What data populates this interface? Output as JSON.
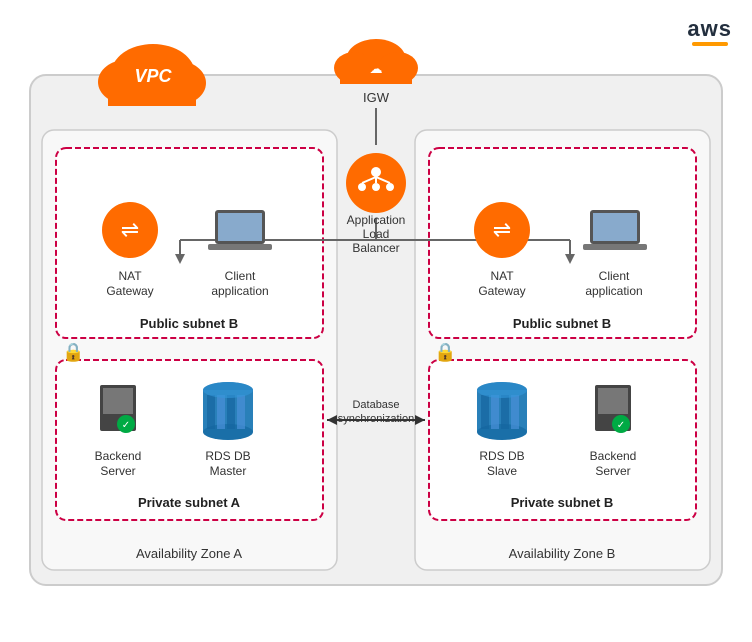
{
  "aws": {
    "logo_text": "aws",
    "underline_color": "#FF9900"
  },
  "vpc": {
    "label": "VPC",
    "cloud_color": "#FF6B00"
  },
  "igw": {
    "label": "IGW"
  },
  "alb": {
    "label_line1": "Application",
    "label_line2": "Load",
    "label_line3": "Balancer"
  },
  "left_az": {
    "az_label": "Availability Zone A",
    "public_subnet_label": "Public subnet B",
    "private_subnet_label": "Private subnet A",
    "nat_label_line1": "NAT",
    "nat_label_line2": "Gateway",
    "client_label_line1": "Client",
    "client_label_line2": "application",
    "backend_label_line1": "Backend",
    "backend_label_line2": "Server",
    "rds_label_line1": "RDS DB",
    "rds_label_line2": "Master"
  },
  "right_az": {
    "az_label": "Availability Zone B",
    "public_subnet_label": "Public subnet B",
    "private_subnet_label": "Private subnet B",
    "nat_label_line1": "NAT",
    "nat_label_line2": "Gateway",
    "client_label_line1": "Client",
    "client_label_line2": "application",
    "rds_label_line1": "RDS DB",
    "rds_label_line2": "Slave",
    "backend_label_line1": "Backend",
    "backend_label_line2": "Server"
  },
  "db_sync": {
    "label_line1": "Database",
    "label_line2": "synchronization"
  }
}
